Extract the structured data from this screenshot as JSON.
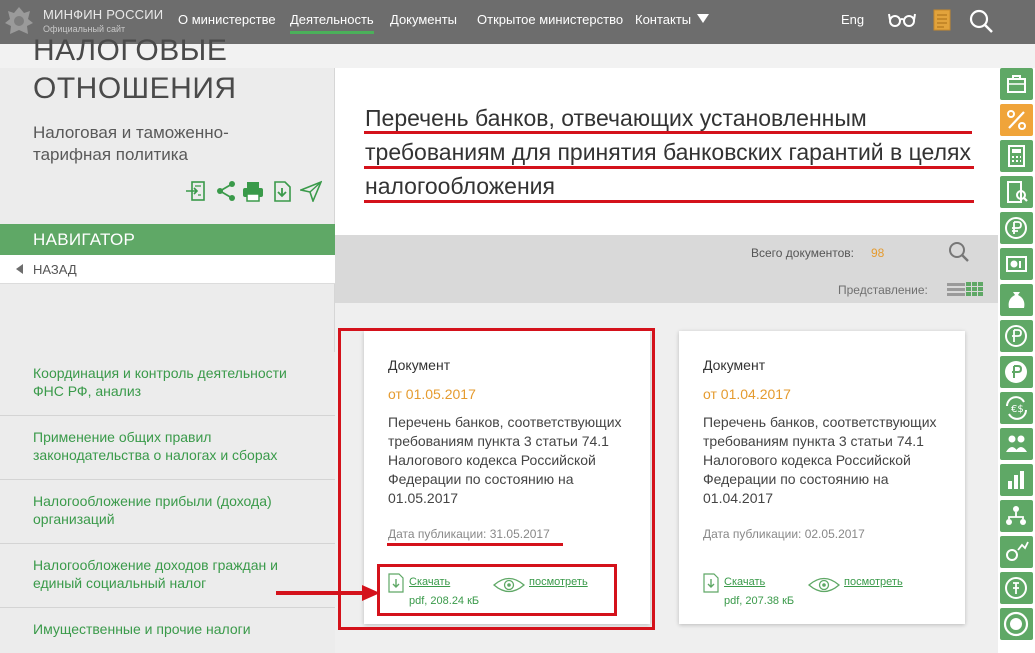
{
  "header": {
    "brand": "МИНФИН РОССИИ",
    "brand_sub": "Официальный сайт",
    "nav": [
      "О министерстве",
      "Деятельность",
      "Документы",
      "Открытое министерство",
      "Контакты"
    ],
    "active_nav": "Деятельность",
    "lang": "Eng"
  },
  "sidebar": {
    "title": "НАЛОГОВЫЕ ОТНОШЕНИЯ",
    "subtitle": "Налоговая и таможенно-тарифная политика",
    "navigator": "НАВИГАТОР",
    "back": "НАЗАД",
    "items": [
      {
        "label": "Координация и контроль деятельности ФНС РФ, анализ"
      },
      {
        "label": "Применение общих правил законодательства о налогах и сборах"
      },
      {
        "label": "Налогообложение прибыли (дохода) организаций"
      },
      {
        "label": "Налогообложение доходов граждан и единый социальный налог"
      },
      {
        "label": "Имущественные и прочие налоги"
      }
    ]
  },
  "main": {
    "title": "Перечень банков, отвечающих установленным требованиям для принятия банковских гарантий в целях налогообложения",
    "total_label": "Всего документов:",
    "total_count": "98",
    "view_label": "Представление:",
    "cards": [
      {
        "type": "Документ",
        "date": "от 01.05.2017",
        "desc": "Перечень банков, соответствующих требованиям пункта 3 статьи 74.1 Налогового кодекса Российской Федерации по состоянию на 01.05.2017",
        "published": "Дата публикации: 31.05.2017",
        "download": "Скачать",
        "file_meta": "pdf, 208.24 кБ",
        "view": "посмотреть"
      },
      {
        "type": "Документ",
        "date": "от 01.04.2017",
        "desc": "Перечень банков, соответствующих требованиям пункта 3 статьи 74.1 Налогового кодекса Российской Федерации по состоянию на 01.04.2017",
        "published": "Дата публикации: 02.05.2017",
        "download": "Скачать",
        "file_meta": "pdf, 207.38 кБ",
        "view": "посмотреть"
      }
    ]
  },
  "colors": {
    "accent_green": "#5fa866",
    "link_green": "#3a9a4a",
    "date_orange": "#e59b2f",
    "annotation_red": "#d4121b",
    "header_gray": "#6d6d6d"
  },
  "icons": {
    "header": [
      "emblem-icon",
      "glasses-icon",
      "document-icon",
      "search-icon"
    ],
    "tools": [
      "export-icon",
      "share-icon",
      "print-icon",
      "download-icon",
      "send-icon"
    ],
    "right_strip": [
      "briefcase-icon",
      "percent-icon",
      "calculator-icon",
      "report-search-icon",
      "globe-ruble-icon",
      "coin-card-icon",
      "money-bag-icon",
      "ruble-coin-icon",
      "ruble-circle-icon",
      "euro-exchange-icon",
      "people-icon",
      "bar-chart-icon",
      "network-icon",
      "settings-chart-icon",
      "coin-icon"
    ]
  }
}
